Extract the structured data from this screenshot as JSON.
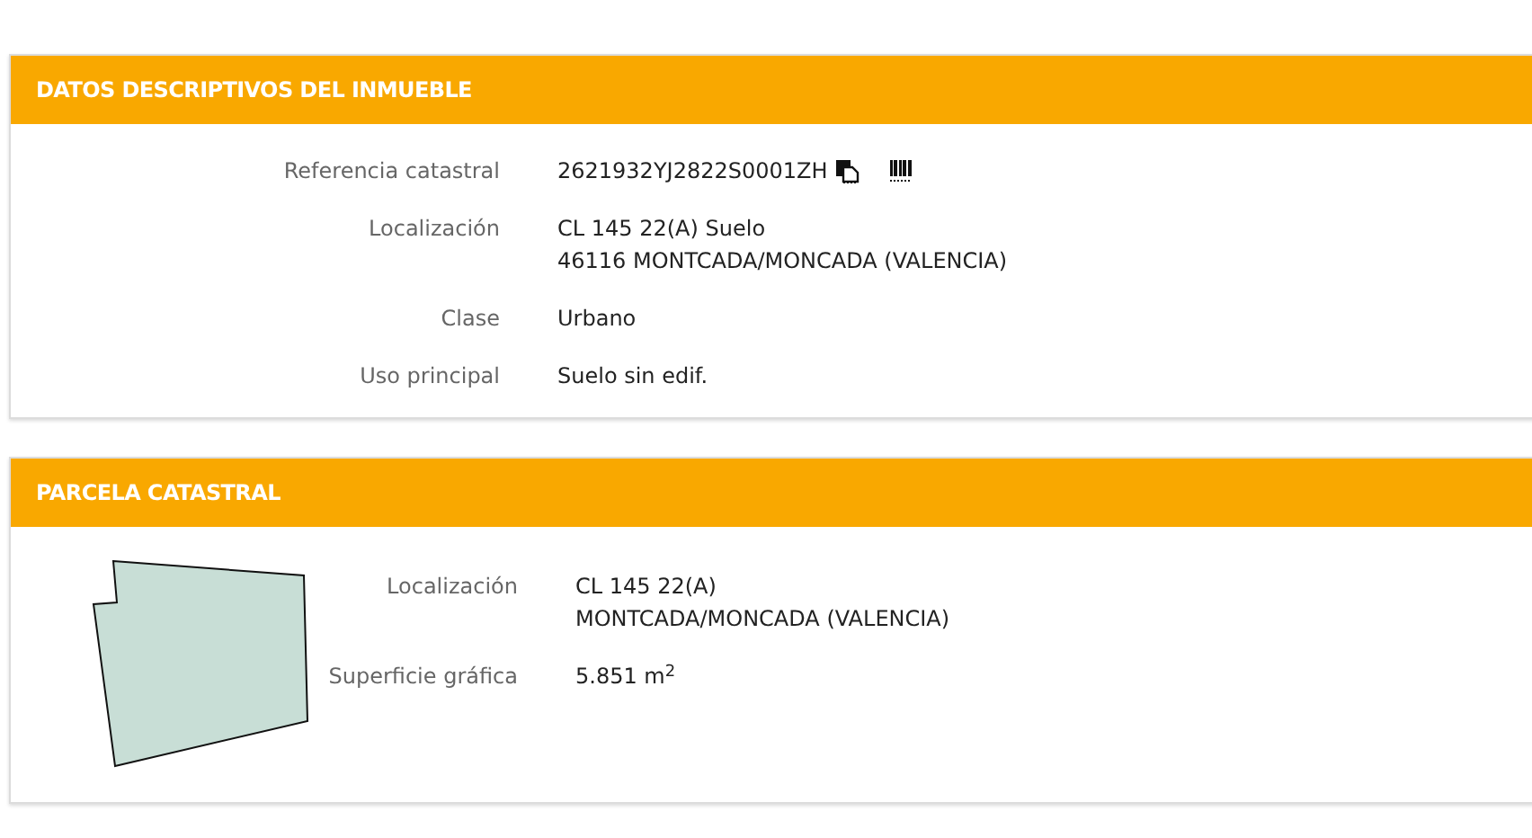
{
  "sections": [
    {
      "title": "DATOS DESCRIPTIVOS DEL INMUEBLE",
      "kind": "details",
      "rows": [
        {
          "kind": "reference",
          "label": "Referencia catastral",
          "lines": [
            "2621932YJ2822S0001ZH"
          ]
        },
        {
          "kind": "text",
          "label": "Localización",
          "lines": [
            "CL 145 22(A) Suelo",
            "46116 MONTCADA/MONCADA (VALENCIA)"
          ]
        },
        {
          "kind": "text",
          "label": "Clase",
          "lines": [
            "Urbano"
          ]
        },
        {
          "kind": "text",
          "label": "Uso principal",
          "lines": [
            "Suelo sin edif."
          ]
        }
      ]
    },
    {
      "title": "PARCELA CATASTRAL",
      "kind": "parcel",
      "rows": [
        {
          "kind": "text",
          "label": "Localización",
          "lines": [
            "CL 145 22(A)",
            "MONTCADA/MONCADA (VALENCIA)"
          ]
        },
        {
          "kind": "text",
          "label": "Superficie gráfica",
          "lines": [
            "5.851 m$^{2}$"
          ]
        }
      ]
    }
  ]
}
